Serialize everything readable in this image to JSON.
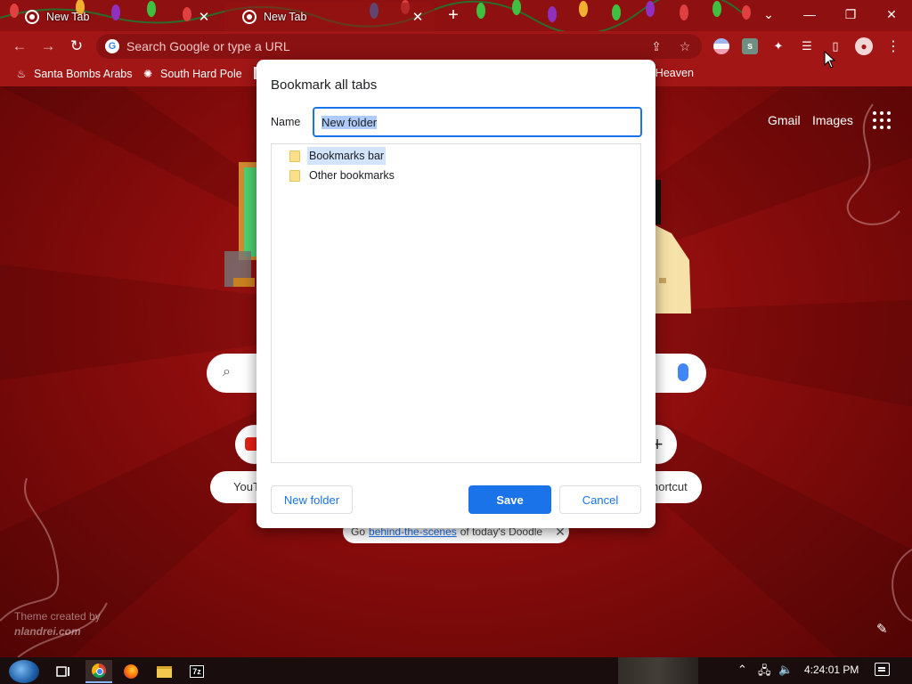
{
  "window": {
    "tabs": [
      {
        "title": "New Tab",
        "active": false
      },
      {
        "title": "New Tab",
        "active": true
      }
    ],
    "new_tab_symbol": "+",
    "controls": {
      "tab_search": "⌄",
      "minimize": "—",
      "restore": "❐",
      "close": "✕"
    }
  },
  "toolbar": {
    "back": "←",
    "forward": "→",
    "reload": "↻",
    "omnibox": {
      "placeholder": "Search Google or type a URL",
      "logo": "G"
    },
    "share": "⇪",
    "star": "☆",
    "extensions": {
      "ext2": "s",
      "puzzle": "✦",
      "reading_list": "☰",
      "side_panel": "▯",
      "profile": "●",
      "menu": "⋮"
    }
  },
  "bookmarks_bar": [
    {
      "label": "Santa Bombs Arabs",
      "icon": "♨"
    },
    {
      "label": "South Hard Pole",
      "icon": "✺"
    },
    {
      "label": "",
      "icon": "▮"
    },
    {
      "label": "K Heaven",
      "icon": ""
    }
  ],
  "ntp": {
    "gmail": "Gmail",
    "images": "Images",
    "search_icon": "⌕",
    "shortcut_youtube_label": "YouT",
    "shortcut_add_label": "hortcut",
    "add_symbol": "+",
    "doodle_promo": {
      "prefix": "Go",
      "link": "behind-the-scenes",
      "suffix": "of today's Doodle",
      "close": "✕"
    },
    "theme_credit": {
      "line1": "Theme created by",
      "line2": "nlandrei.com"
    },
    "edit": "✎"
  },
  "dialog": {
    "title": "Bookmark all tabs",
    "name_label": "Name",
    "name_value": "New folder",
    "folders": [
      {
        "label": "Bookmarks bar",
        "selected": true
      },
      {
        "label": "Other bookmarks",
        "selected": false
      }
    ],
    "buttons": {
      "new_folder": "New folder",
      "save": "Save",
      "cancel": "Cancel"
    }
  },
  "taskbar": {
    "apps": [
      {
        "name": "Task View"
      },
      {
        "name": "Google Chrome"
      },
      {
        "name": "Firefox"
      },
      {
        "name": "File Explorer"
      },
      {
        "name": "7-Zip"
      }
    ],
    "seven_zip_label": "7z",
    "tray": {
      "up": "⌃",
      "network": "🖧",
      "volume": "🔈"
    },
    "clock": "4:24:01 PM"
  },
  "colors": {
    "chrome_frame": "#8e1010",
    "toolbar": "#a21616",
    "accent": "#1a73e8",
    "selection": "#d2e3fc"
  }
}
